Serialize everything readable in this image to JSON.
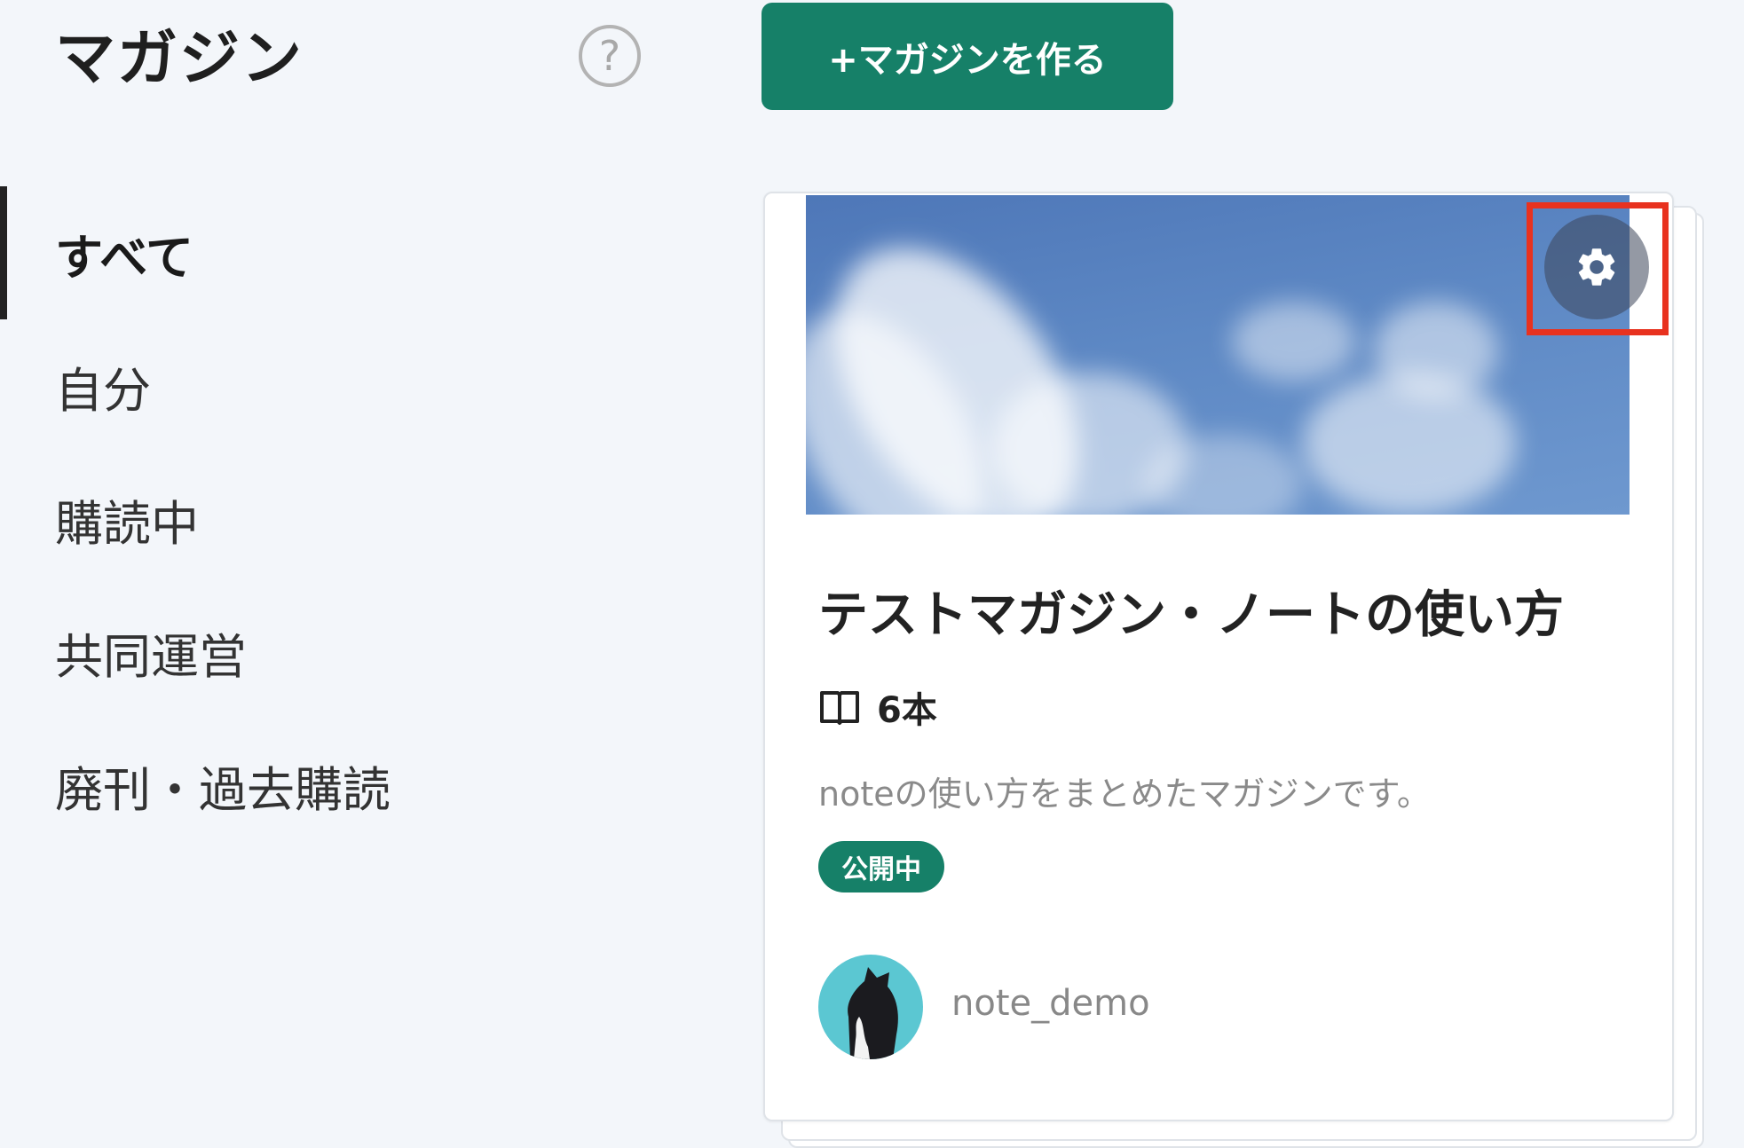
{
  "header": {
    "title": "マガジン",
    "help_icon": "?",
    "create_button_label": "+マガジンを作る"
  },
  "sidebar": {
    "items": [
      {
        "label": "すべて",
        "active": true
      },
      {
        "label": "自分",
        "active": false
      },
      {
        "label": "購読中",
        "active": false
      },
      {
        "label": "共同運営",
        "active": false
      },
      {
        "label": "廃刊・過去購読",
        "active": false
      }
    ]
  },
  "magazine_card": {
    "cover_image": "sky-with-clouds",
    "settings_icon": "gear-icon",
    "title": "テストマガジン・ノートの使い方",
    "count_icon": "book-icon",
    "count_label": "6本",
    "description": "noteの使い方をまとめたマガジンです。",
    "status_badge": "公開中",
    "author_name": "note_demo"
  },
  "colors": {
    "accent": "#168068",
    "highlight": "#e8321f",
    "background": "#f3f6fa"
  }
}
